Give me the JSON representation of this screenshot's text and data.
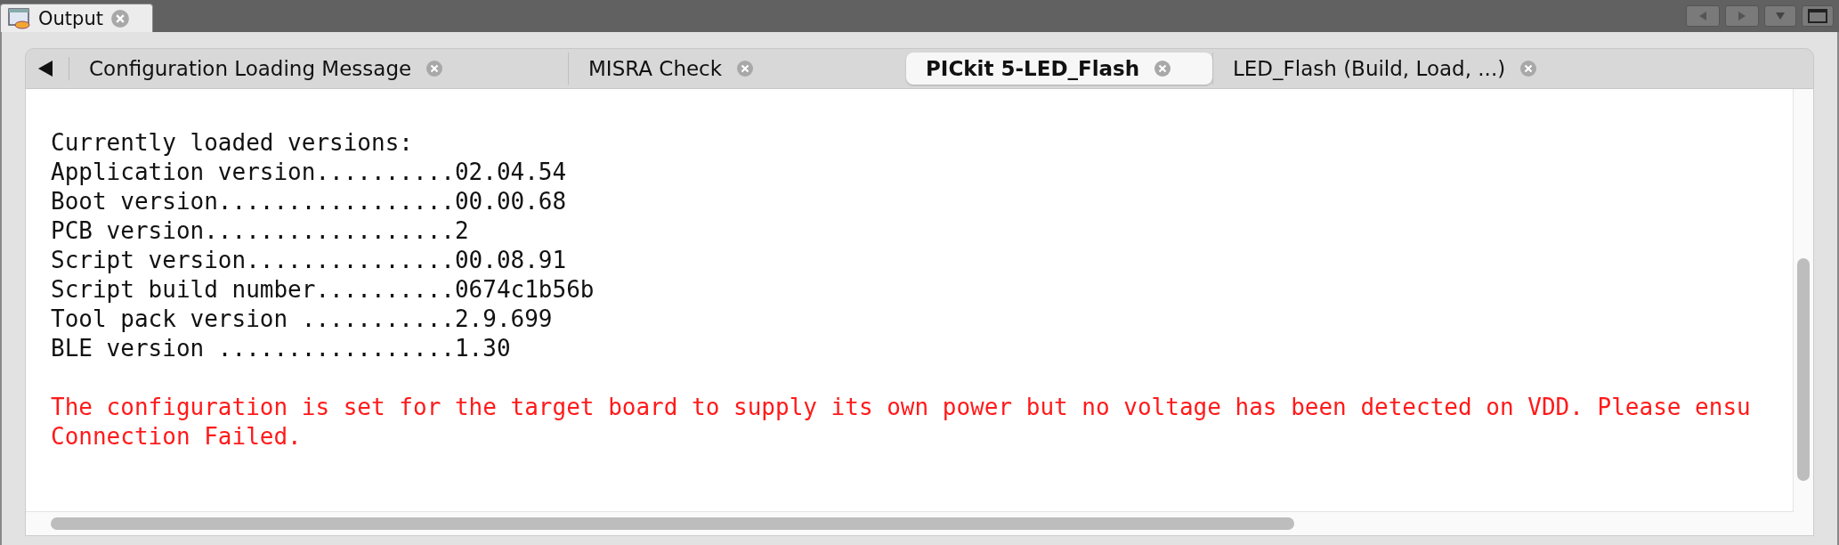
{
  "panel_tab": {
    "title": "Output",
    "selected": true
  },
  "tabs": [
    {
      "label": "Configuration Loading Message",
      "selected": false
    },
    {
      "label": "MISRA Check",
      "selected": false
    },
    {
      "label": "PICkit 5-LED_Flash",
      "selected": true
    },
    {
      "label": "LED_Flash (Build, Load, ...)",
      "selected": false
    }
  ],
  "lines": [
    {
      "text": "Currently loaded versions:",
      "kind": "normal"
    },
    {
      "text": "Application version..........02.04.54",
      "kind": "normal"
    },
    {
      "text": "Boot version.................00.00.68",
      "kind": "normal"
    },
    {
      "text": "PCB version..................2",
      "kind": "normal"
    },
    {
      "text": "Script version...............00.08.91",
      "kind": "normal"
    },
    {
      "text": "Script build number..........0674c1b56b",
      "kind": "normal"
    },
    {
      "text": "Tool pack version ...........2.9.699",
      "kind": "normal"
    },
    {
      "text": "BLE version .................1.30",
      "kind": "normal"
    },
    {
      "kind": "blank"
    },
    {
      "text": "The configuration is set for the target board to supply its own power but no voltage has been detected on VDD. Please ensu",
      "kind": "error"
    },
    {
      "text": "Connection Failed.",
      "kind": "error"
    }
  ]
}
